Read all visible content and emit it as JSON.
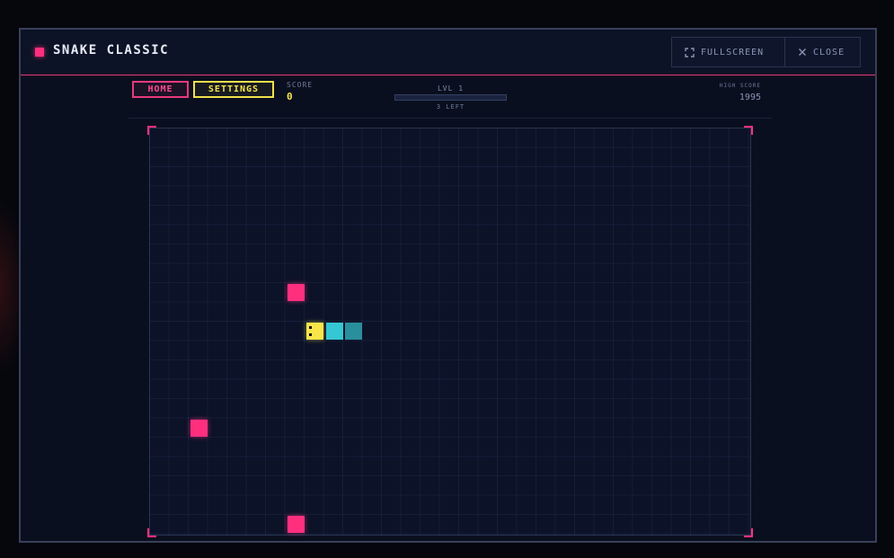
{
  "window": {
    "title": "SNAKE CLASSIC",
    "fullscreen_label": "FULLSCREEN",
    "close_label": "CLOSE"
  },
  "hud": {
    "home_label": "HOME",
    "settings_label": "SETTINGS",
    "score_label": "SCORE",
    "score_value": "0",
    "level_label": "LVL 1",
    "level_progress": 0,
    "remaining_label": "3 LEFT",
    "high_score_label": "HIGH SCORE",
    "high_score_value": "1995"
  },
  "board": {
    "cols": 31,
    "rows": 21,
    "snake": [
      {
        "col": 8,
        "row": 10
      },
      {
        "col": 9,
        "row": 10
      },
      {
        "col": 10,
        "row": 10
      }
    ],
    "food": [
      {
        "col": 7,
        "row": 8
      },
      {
        "col": 2,
        "row": 15
      },
      {
        "col": 7,
        "row": 20
      }
    ]
  },
  "colors": {
    "accent_pink": "#ff2f7e",
    "accent_yellow": "#f7e54a",
    "snake_body": "#35c7d4",
    "snake_tail": "#2a8f9c",
    "board_bg": "#0c1228"
  },
  "icons": {
    "fullscreen": "fullscreen-icon",
    "close": "close-icon"
  }
}
